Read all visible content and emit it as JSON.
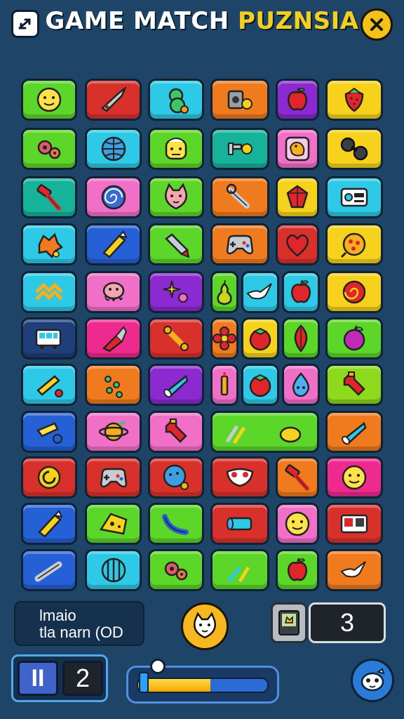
{
  "header": {
    "title_white": "GAME MATCH ",
    "title_yellow": "PUZNSIA",
    "left_button_icon": "swap-arrows-icon",
    "close_button_icon": "close-icon"
  },
  "board": {
    "colors": {
      "green": "#5dd62a",
      "red": "#d8312c",
      "cyan": "#2ec9e6",
      "orange": "#f07a1e",
      "purple": "#8a2ad0",
      "yellow": "#f7d21c",
      "teal": "#16b39a",
      "pink": "#f070c8",
      "blue": "#2660d6",
      "lime": "#8ed81e",
      "magenta": "#ee2a8e",
      "darkblue": "#1f3f7a"
    },
    "tiles": [
      {
        "color": "green",
        "icon": "emoji-face-icon"
      },
      {
        "color": "red",
        "icon": "dagger-icon"
      },
      {
        "color": "cyan",
        "icon": "gourd-icon"
      },
      {
        "color": "orange",
        "icon": "camera-gear-icon"
      },
      {
        "color": "purple",
        "icon": "apple-icon"
      },
      {
        "color": "yellow",
        "icon": "strawberry-icon"
      },
      {
        "color": "green",
        "icon": "gears-icon"
      },
      {
        "color": "cyan",
        "icon": "globe-icon"
      },
      {
        "color": "green",
        "icon": "robot-face-icon"
      },
      {
        "color": "teal",
        "icon": "wrench-gear-icon"
      },
      {
        "color": "pink",
        "icon": "bird-icon"
      },
      {
        "color": "yellow",
        "icon": "dumbbell-icon"
      },
      {
        "color": "teal",
        "icon": "hammer-icon"
      },
      {
        "color": "pink",
        "icon": "spiral-icon"
      },
      {
        "color": "green",
        "icon": "cat-face-icon"
      },
      {
        "color": "orange",
        "icon": "wrench-icon"
      },
      {
        "color": "yellow",
        "icon": "gem-icon"
      },
      {
        "color": "cyan",
        "icon": "radio-icon"
      },
      {
        "color": "cyan",
        "icon": "splat-icon"
      },
      {
        "color": "blue",
        "icon": "crayon-icon"
      },
      {
        "color": "green",
        "icon": "marker-icon"
      },
      {
        "color": "orange",
        "icon": "gamepad-icon"
      },
      {
        "color": "red",
        "icon": "heart-icon"
      },
      {
        "color": "yellow",
        "icon": "pizza-icon"
      },
      {
        "color": "cyan",
        "icon": "chevron-pattern-icon"
      },
      {
        "color": "pink",
        "icon": "octopus-icon"
      },
      {
        "color": "purple",
        "icon": "sparkle-icon"
      },
      {
        "color": "green",
        "icon": "pear-icon"
      },
      {
        "color": "cyan",
        "icon": "bird-flying-icon"
      },
      {
        "color": "cyan",
        "icon": "apple-icon"
      },
      {
        "color": "yellow",
        "icon": "swirl-icon"
      },
      {
        "color": "darkblue",
        "icon": "bus-icon"
      },
      {
        "color": "magenta",
        "icon": "brush-icon"
      },
      {
        "color": "red",
        "icon": "bone-icon"
      },
      {
        "color": "orange",
        "icon": "flower-icon"
      },
      {
        "color": "yellow",
        "icon": "tomato-icon"
      },
      {
        "color": "green",
        "icon": "leaf-icon"
      },
      {
        "color": "green",
        "icon": "plum-icon"
      },
      {
        "color": "cyan",
        "icon": "pencil-icon"
      },
      {
        "color": "orange",
        "icon": "dice-icon"
      },
      {
        "color": "purple",
        "icon": "cone-icon"
      },
      {
        "color": "pink",
        "icon": "candle-icon"
      },
      {
        "color": "cyan",
        "icon": "tomato-icon"
      },
      {
        "color": "pink",
        "icon": "droplet-face-icon"
      },
      {
        "color": "lime",
        "icon": "bottle-icon"
      },
      {
        "color": "blue",
        "icon": "pin-icon"
      },
      {
        "color": "pink",
        "icon": "planet-icon"
      },
      {
        "color": "pink",
        "icon": "bottle-icon"
      },
      {
        "color": "green",
        "icon": "pens-lemon-icon"
      },
      {
        "color": "orange",
        "icon": "cone-icon"
      },
      {
        "color": "red",
        "icon": "ring-icon"
      },
      {
        "color": "red",
        "icon": "gamepad-icon"
      },
      {
        "color": "red",
        "icon": "chat-bubble-icon"
      },
      {
        "color": "red",
        "icon": "mask-icon"
      },
      {
        "color": "orange",
        "icon": "hammer-icon"
      },
      {
        "color": "magenta",
        "icon": "emoji-face-icon"
      },
      {
        "color": "blue",
        "icon": "crayon-icon"
      },
      {
        "color": "green",
        "icon": "cheese-icon"
      },
      {
        "color": "green",
        "icon": "banana-icon"
      },
      {
        "color": "red",
        "icon": "tube-icon"
      },
      {
        "color": "pink",
        "icon": "emoji-face-icon"
      },
      {
        "color": "red",
        "icon": "tv-icon"
      },
      {
        "color": "blue",
        "icon": "pipe-icon"
      },
      {
        "color": "cyan",
        "icon": "cage-icon"
      },
      {
        "color": "green",
        "icon": "gears-icon"
      },
      {
        "color": "green",
        "icon": "pens-icon"
      },
      {
        "color": "green",
        "icon": "apple-icon"
      },
      {
        "color": "orange",
        "icon": "bird-flying-icon"
      }
    ]
  },
  "status": {
    "left_line1": "lmaio",
    "left_line2": "tla narn (OD",
    "center_button_icon": "cat-face-icon",
    "moves_icon": "device-icon",
    "moves_value": "3",
    "pause_label": "II",
    "level_value": "2",
    "progress_fraction": 0.55,
    "settings_icon": "mask-face-icon"
  }
}
